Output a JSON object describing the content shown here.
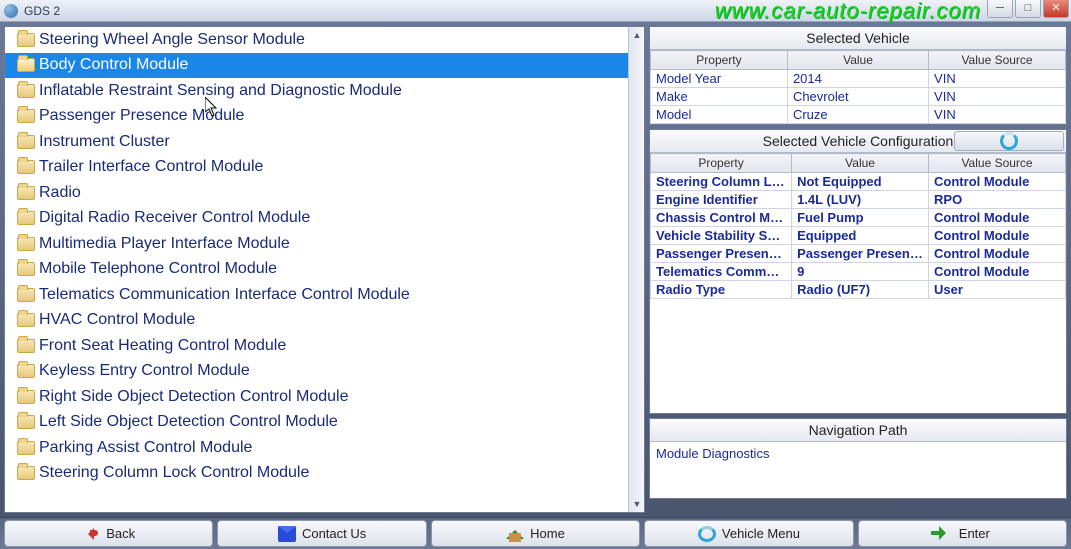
{
  "window": {
    "title": "GDS 2",
    "watermark": "www.car-auto-repair.com"
  },
  "modules": [
    {
      "label": "Steering Wheel Angle Sensor Module",
      "selected": false
    },
    {
      "label": "Body Control Module",
      "selected": true
    },
    {
      "label": "Inflatable Restraint Sensing and Diagnostic Module",
      "selected": false
    },
    {
      "label": "Passenger Presence Module",
      "selected": false
    },
    {
      "label": "Instrument Cluster",
      "selected": false
    },
    {
      "label": "Trailer Interface Control Module",
      "selected": false
    },
    {
      "label": "Radio",
      "selected": false
    },
    {
      "label": "Digital Radio Receiver Control Module",
      "selected": false
    },
    {
      "label": "Multimedia Player Interface Module",
      "selected": false
    },
    {
      "label": "Mobile Telephone Control Module",
      "selected": false
    },
    {
      "label": "Telematics Communication Interface Control Module",
      "selected": false
    },
    {
      "label": "HVAC Control Module",
      "selected": false
    },
    {
      "label": "Front Seat Heating Control Module",
      "selected": false
    },
    {
      "label": "Keyless Entry Control Module",
      "selected": false
    },
    {
      "label": "Right Side Object Detection Control Module",
      "selected": false
    },
    {
      "label": "Left Side Object Detection Control Module",
      "selected": false
    },
    {
      "label": "Parking Assist Control Module",
      "selected": false
    },
    {
      "label": "Steering Column Lock Control Module",
      "selected": false
    }
  ],
  "selected_vehicle": {
    "title": "Selected Vehicle",
    "columns": {
      "property": "Property",
      "value": "Value",
      "source": "Value Source"
    },
    "rows": [
      {
        "property": "Model Year",
        "value": "2014",
        "source": "VIN"
      },
      {
        "property": "Make",
        "value": "Chevrolet",
        "source": "VIN"
      },
      {
        "property": "Model",
        "value": "Cruze",
        "source": "VIN"
      }
    ]
  },
  "vehicle_config": {
    "title": "Selected Vehicle Configuration",
    "columns": {
      "property": "Property",
      "value": "Value",
      "source": "Value Source"
    },
    "rows": [
      {
        "property": "Steering Column Lo...",
        "value": "Not Equipped",
        "source": "Control Module"
      },
      {
        "property": "Engine Identifier",
        "value": "1.4L (LUV)",
        "source": "RPO"
      },
      {
        "property": "Chassis Control Mo...",
        "value": "Fuel Pump",
        "source": "Control Module"
      },
      {
        "property": "Vehicle Stability Sys...",
        "value": "Equipped",
        "source": "Control Module"
      },
      {
        "property": "Passenger Presenc...",
        "value": "Passenger Presenc...",
        "source": "Control Module"
      },
      {
        "property": "Telematics Commun...",
        "value": "9",
        "source": "Control Module"
      },
      {
        "property": "Radio Type",
        "value": "Radio (UF7)",
        "source": "User"
      }
    ]
  },
  "navigation": {
    "title": "Navigation Path",
    "path": "Module Diagnostics"
  },
  "bottom": {
    "back": "Back",
    "contact": "Contact Us",
    "home": "Home",
    "vmenu": "Vehicle Menu",
    "enter": "Enter"
  }
}
